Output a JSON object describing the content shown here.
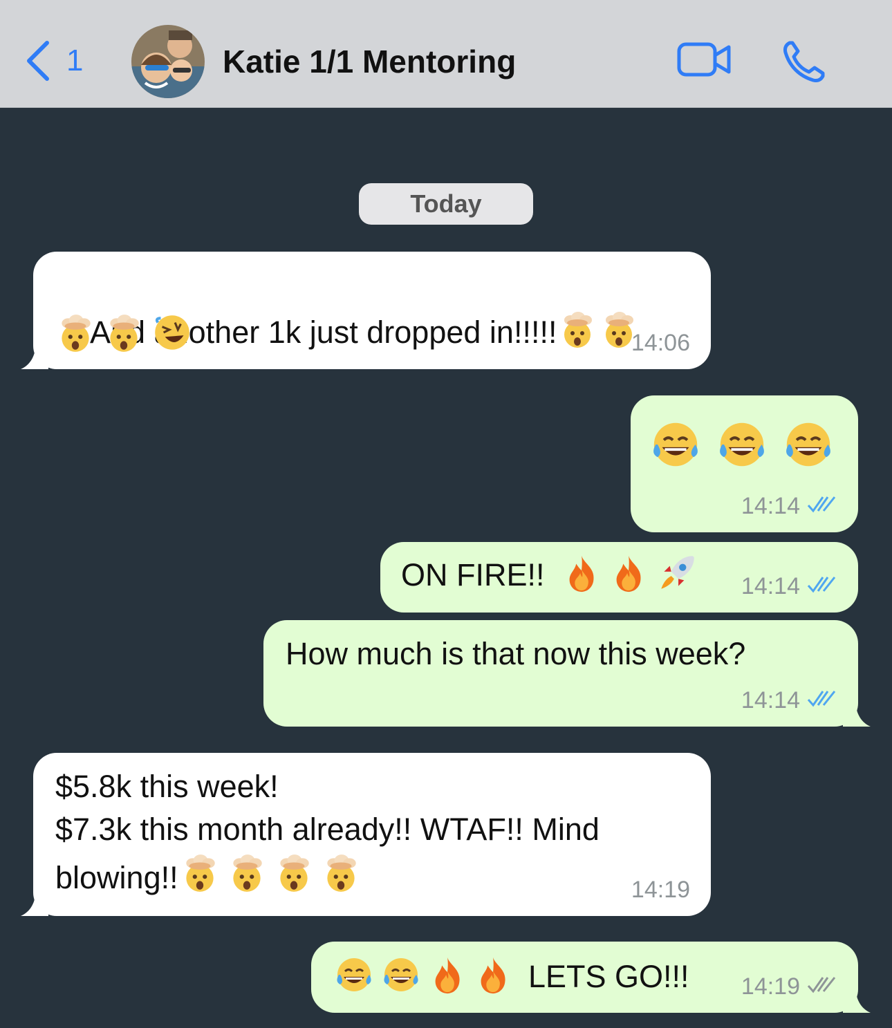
{
  "header": {
    "back_count": "1",
    "title": "Katie 1/1 Mentoring",
    "icons": {
      "back": "chevron-left-icon",
      "video": "video-camera-icon",
      "call": "phone-icon"
    },
    "accent": "#2f7cf6",
    "bg": "#d3d5d8"
  },
  "chat": {
    "bg": "#27333d",
    "date_chip": "Today",
    "incoming_bg": "#ffffff",
    "outgoing_bg": "#e2fdd3",
    "read_tick_color": "#4fa6f0",
    "delivered_tick_color": "#8e9497",
    "messages": [
      {
        "dir": "in",
        "line1": "And another 1k just dropped in!!!!!",
        "emojis_after": [
          "mind-blown",
          "mind-blown"
        ],
        "line2_emojis": [
          "mind-blown",
          "mind-blown",
          "rofl"
        ],
        "time": "14:06"
      },
      {
        "dir": "out",
        "emojis": [
          "tears-of-joy",
          "tears-of-joy",
          "tears-of-joy"
        ],
        "time": "14:14",
        "status": "read"
      },
      {
        "dir": "out",
        "text": "ON FIRE!!",
        "emojis": [
          "fire",
          "fire",
          "rocket"
        ],
        "time": "14:14",
        "status": "read"
      },
      {
        "dir": "out",
        "text": "How much is that now this week?",
        "time": "14:14",
        "status": "read"
      },
      {
        "dir": "in",
        "line1": "$5.8k this week!",
        "line2": "$7.3k this month already!! WTAF!! Mind",
        "line3": "blowing!!",
        "emojis": [
          "mind-blown",
          "mind-blown",
          "mind-blown",
          "mind-blown"
        ],
        "time": "14:19"
      },
      {
        "dir": "out",
        "emojis_before": [
          "tears-of-joy",
          "tears-of-joy",
          "fire",
          "fire"
        ],
        "text": "LETS GO!!!",
        "time": "14:19",
        "status": "delivered"
      }
    ]
  }
}
